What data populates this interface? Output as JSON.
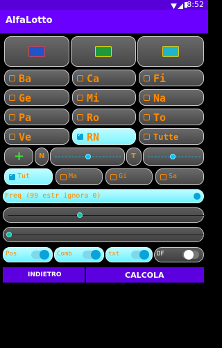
{
  "status_bar": {
    "time": "8:52"
  },
  "app": {
    "title": "AlfaLotto"
  },
  "wheels": [
    {
      "label": "Ba",
      "checked": false
    },
    {
      "label": "Ca",
      "checked": false
    },
    {
      "label": "Fi",
      "checked": false
    },
    {
      "label": "Ge",
      "checked": false
    },
    {
      "label": "Mi",
      "checked": false
    },
    {
      "label": "Na",
      "checked": false
    },
    {
      "label": "Pa",
      "checked": false
    },
    {
      "label": "Ro",
      "checked": false
    },
    {
      "label": "To",
      "checked": false
    },
    {
      "label": "Ve",
      "checked": false
    },
    {
      "label": "RN",
      "checked": true
    },
    {
      "label": "Tutte",
      "checked": false
    }
  ],
  "controls": {
    "plus": "+",
    "n_label": "N",
    "t_label": "T"
  },
  "days": [
    {
      "label": "Tut",
      "checked": true
    },
    {
      "label": "Ma",
      "checked": false
    },
    {
      "label": "Gi",
      "checked": false
    },
    {
      "label": "Sa",
      "checked": false
    }
  ],
  "freq_label": "Freq (99 estr ignora 0)",
  "toggles": [
    {
      "label": "Pos",
      "on": true
    },
    {
      "label": "Comb",
      "on": true
    },
    {
      "label": "txt",
      "on": true
    },
    {
      "label": "DF",
      "on": false
    }
  ],
  "buttons": {
    "back": "INDIETRO",
    "compute": "CALCOLA"
  }
}
